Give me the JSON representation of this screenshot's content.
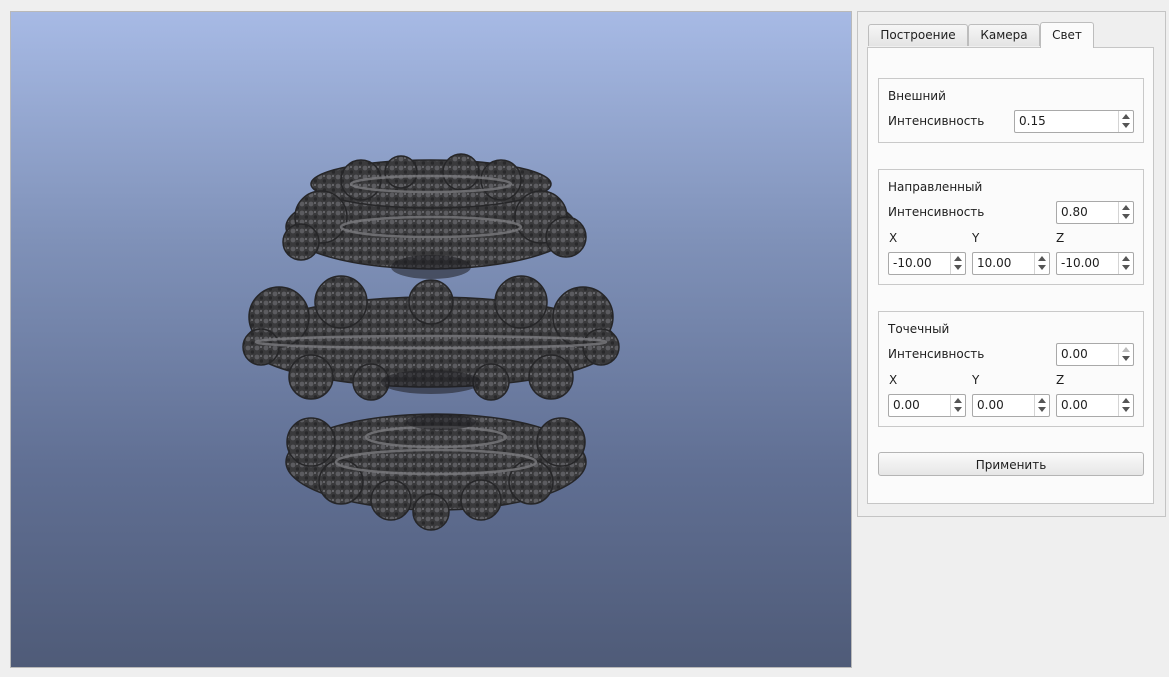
{
  "viewport": {
    "object_icon": "fractal-mesh"
  },
  "tabs": [
    {
      "label": "Построение",
      "active": false
    },
    {
      "label": "Камера",
      "active": false
    },
    {
      "label": "Свет",
      "active": true
    }
  ],
  "ambient": {
    "title": "Внешний",
    "intensity_label": "Интенсивность",
    "intensity": "0.15"
  },
  "directional": {
    "title": "Направленный",
    "intensity_label": "Интенсивность",
    "intensity": "0.80",
    "x_label": "X",
    "y_label": "Y",
    "z_label": "Z",
    "x": "-10.00",
    "y": "10.00",
    "z": "-10.00"
  },
  "point": {
    "title": "Точечный",
    "intensity_label": "Интенсивность",
    "intensity": "0.00",
    "x_label": "X",
    "y_label": "Y",
    "z_label": "Z",
    "x": "0.00",
    "y": "0.00",
    "z": "0.00"
  },
  "apply_label": "Применить",
  "colors": {
    "bg_top": "#a7bae5",
    "bg_bottom": "#4f5b78",
    "fractal": "#3a3a3c",
    "window": "#efefef"
  }
}
